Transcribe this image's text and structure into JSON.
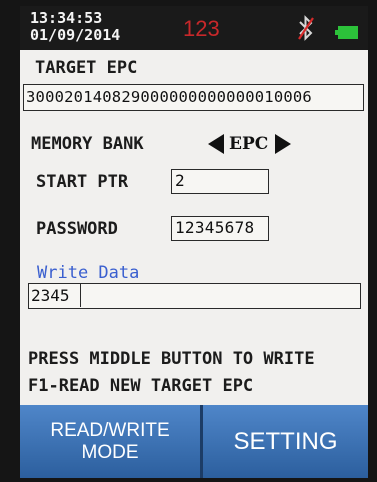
{
  "status": {
    "time": "13:34:53",
    "date": "01/09/2014",
    "tag_count": "123",
    "bluetooth_icon": "bluetooth-icon",
    "battery_icon": "battery-icon",
    "battery_color": "#2cc23a"
  },
  "target_epc": {
    "label": "TARGET EPC",
    "value": "300020140829000000000000010006"
  },
  "memory_bank": {
    "label": "MEMORY BANK",
    "value": "EPC"
  },
  "start_ptr": {
    "label": "START PTR",
    "value": "2"
  },
  "password": {
    "label": "PASSWORD",
    "value": "12345678"
  },
  "write_data": {
    "label": "Write Data",
    "value": "2345"
  },
  "instructions": {
    "line1": "PRESS MIDDLE BUTTON TO WRITE",
    "line2": "F1-READ NEW TARGET EPC"
  },
  "buttons": {
    "mode_line1": "READ/WRITE",
    "mode_line2": "MODE",
    "setting": "SETTING",
    "color": "#3d74b8"
  }
}
